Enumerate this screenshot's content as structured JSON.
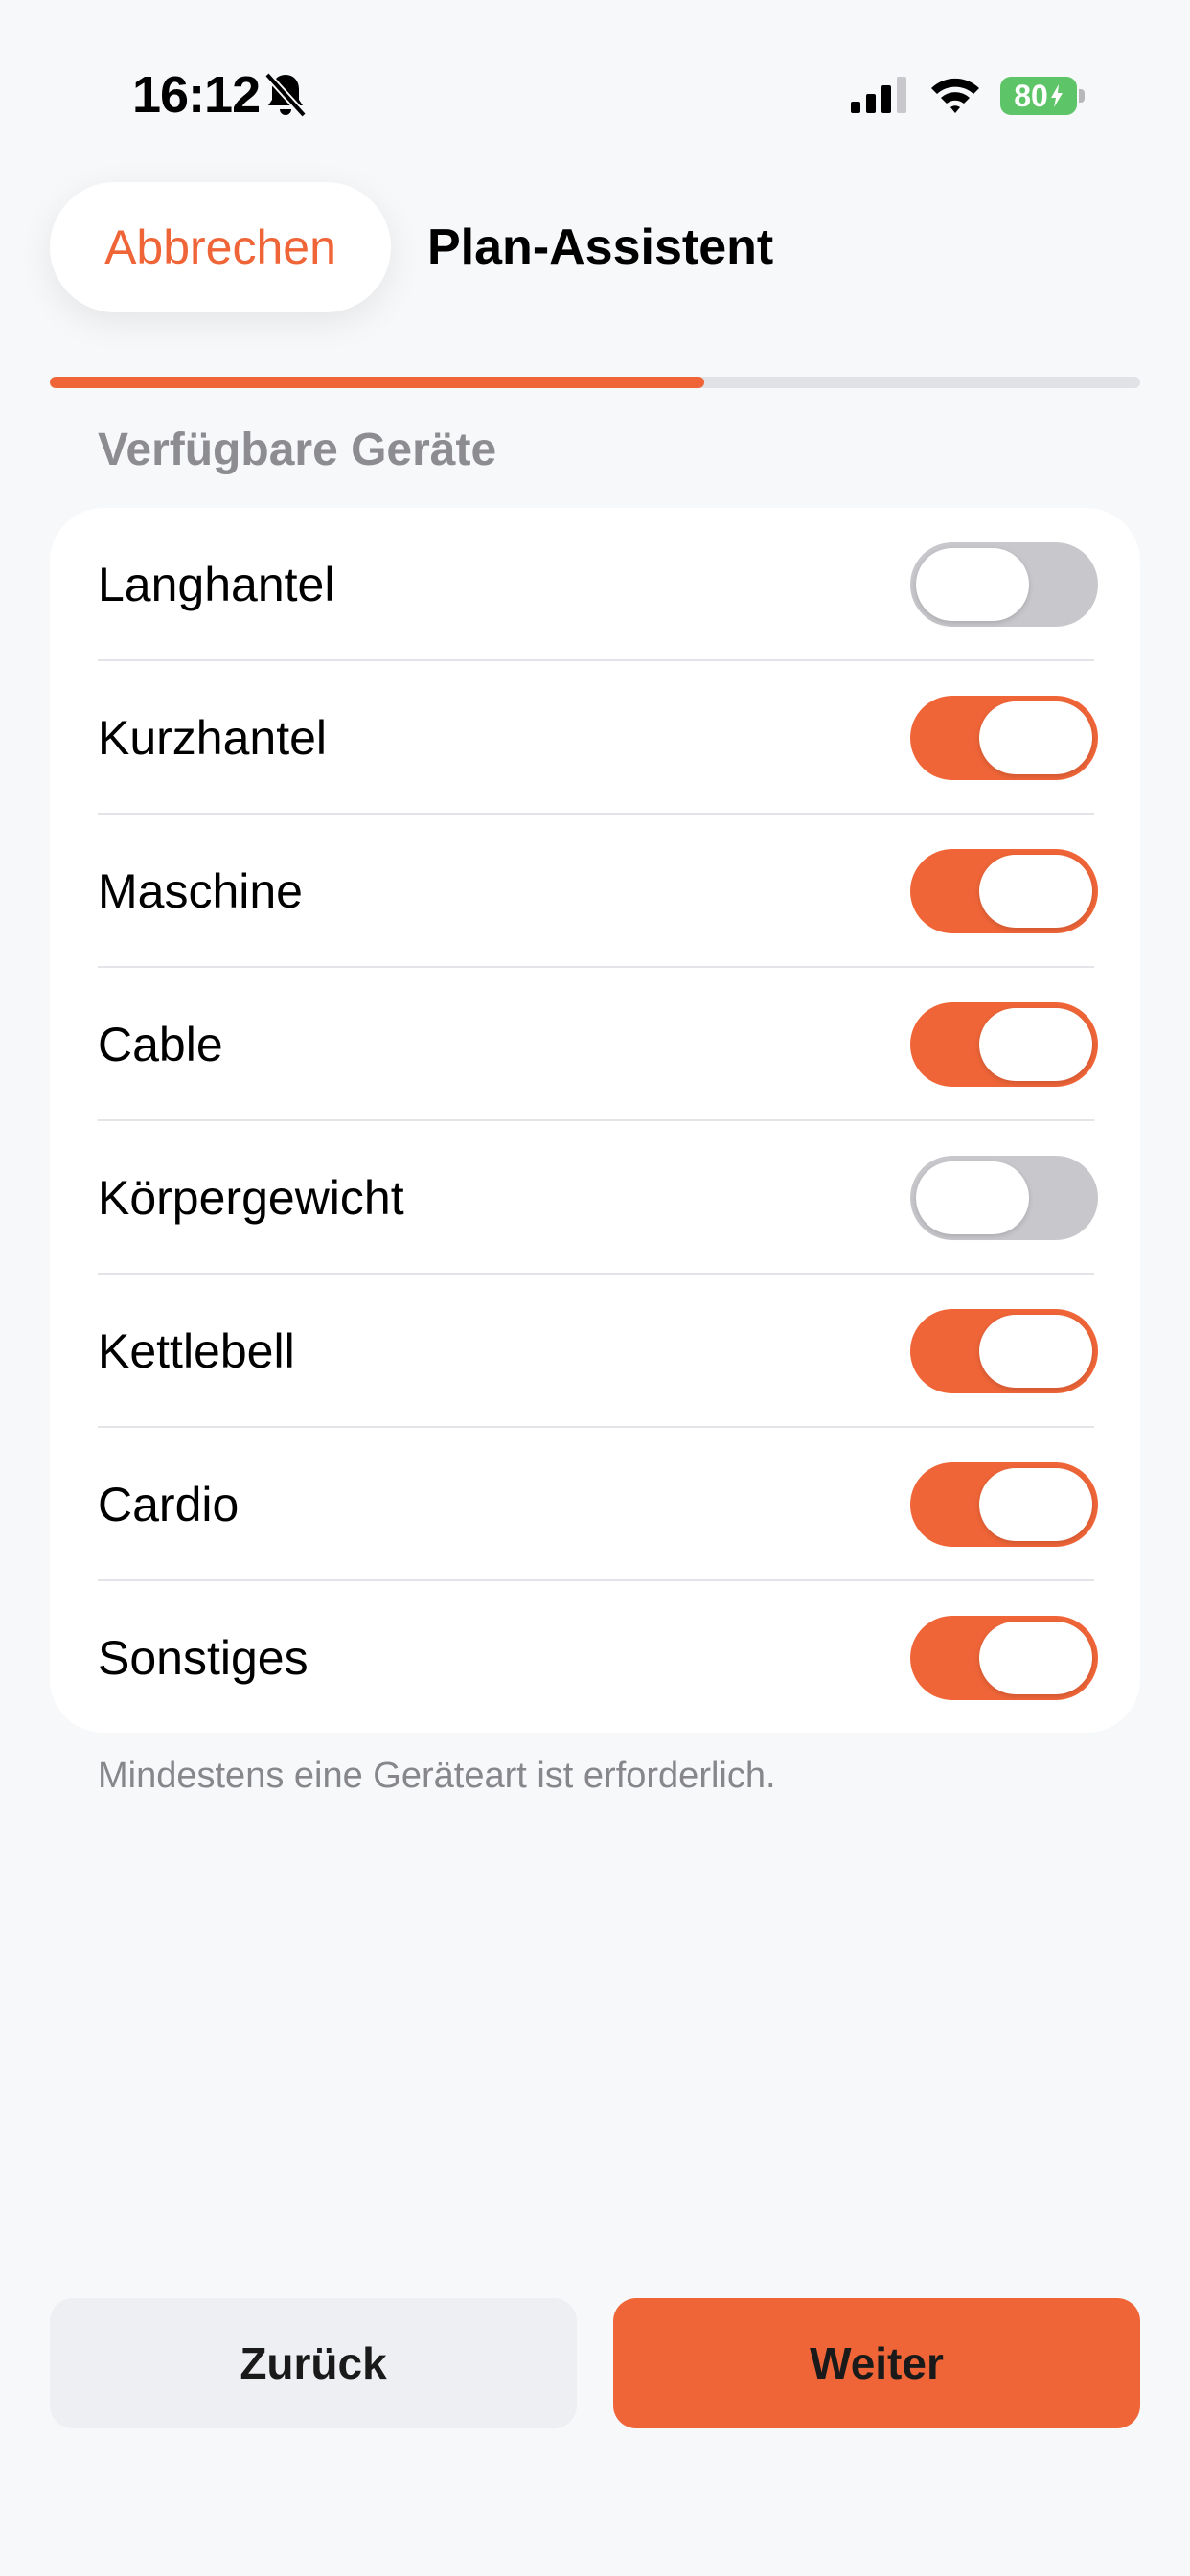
{
  "status_bar": {
    "time": "16:12",
    "battery_level": "80",
    "icons": [
      "bell-slash-icon",
      "signal-icon",
      "wifi-icon",
      "battery-charging-icon"
    ]
  },
  "header": {
    "cancel_label": "Abbrechen",
    "title": "Plan-Assistent"
  },
  "progress": {
    "value_percent": 60
  },
  "section": {
    "title": "Verfügbare Geräte"
  },
  "equipment": [
    {
      "label": "Langhantel",
      "enabled": false
    },
    {
      "label": "Kurzhantel",
      "enabled": true
    },
    {
      "label": "Maschine",
      "enabled": true
    },
    {
      "label": "Cable",
      "enabled": true
    },
    {
      "label": "Körpergewicht",
      "enabled": false
    },
    {
      "label": "Kettlebell",
      "enabled": true
    },
    {
      "label": "Cardio",
      "enabled": true
    },
    {
      "label": "Sonstiges",
      "enabled": true
    }
  ],
  "footnote": "Mindestens eine Geräteart ist erforderlich.",
  "footer": {
    "back_label": "Zurück",
    "next_label": "Weiter"
  },
  "colors": {
    "accent": "#ef6538",
    "toggle_off": "#c8c8cc",
    "background": "#f7f8fa"
  }
}
